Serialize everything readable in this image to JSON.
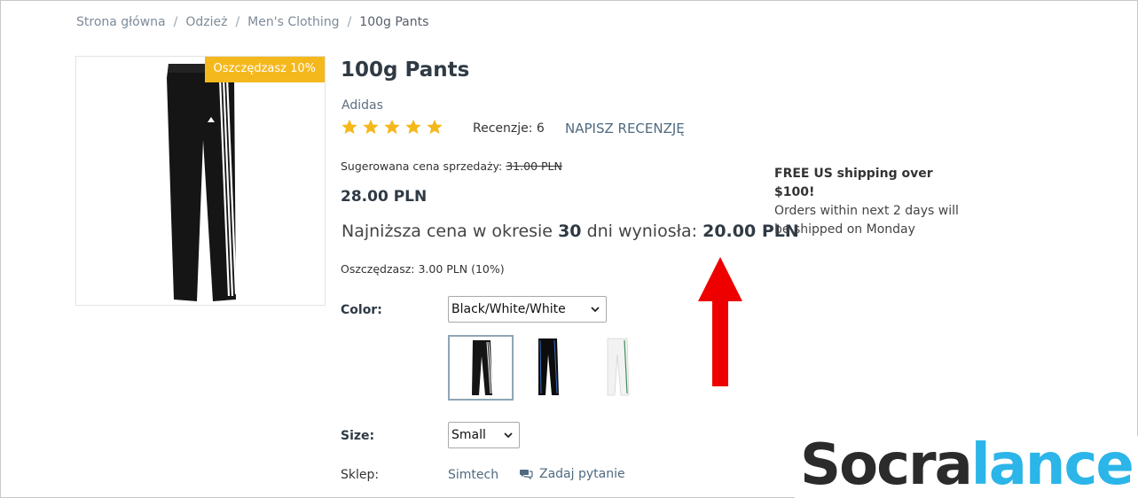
{
  "breadcrumb": {
    "items": [
      "Strona główna",
      "Odzież",
      "Men's Clothing"
    ],
    "separator": "/",
    "current": "100g Pants"
  },
  "product": {
    "discount_badge": "Oszczędzasz 10%",
    "title": "100g Pants",
    "brand": "Adidas",
    "rating": {
      "stars": 5,
      "max": 5
    },
    "reviews_label": "Recenzje: 6",
    "write_review": "NAPISZ RECENZJĘ",
    "suggested_price_label": "Sugerowana cena sprzedaży:",
    "suggested_price": "31.00 PLN",
    "price": "28.00 PLN",
    "lowest_price": {
      "prefix": "Najniższa cena w okresie",
      "days": "30",
      "middle": "dni wyniosła:",
      "value": "20.00 PLN"
    },
    "savings": "Oszczędzasz: 3.00 PLN (10%)"
  },
  "shipping": {
    "headline": "FREE US shipping over $100!",
    "line1": "Orders within next 2 days will",
    "line2": "be shipped on Monday"
  },
  "options": {
    "color_label": "Color:",
    "color_value": "Black/White/White",
    "swatches": [
      "Black/White/White",
      "Black",
      "White"
    ],
    "size_label": "Size:",
    "size_value": "Small"
  },
  "store": {
    "label": "Sklep:",
    "name": "Simtech",
    "ask_question": "Zadaj pytanie"
  },
  "watermark": {
    "part1": "Socra",
    "part2": "lance"
  },
  "colors": {
    "badge": "#f5b81c",
    "star": "#f5b81c",
    "arrow": "#ee0000",
    "link": "#4f6a80",
    "watermark_dark": "#2b2b2b",
    "watermark_accent": "#2bb5e8"
  },
  "icons": [
    "star-icon",
    "chevron-down-icon",
    "chat-bubble-icon",
    "red-arrow-up"
  ]
}
